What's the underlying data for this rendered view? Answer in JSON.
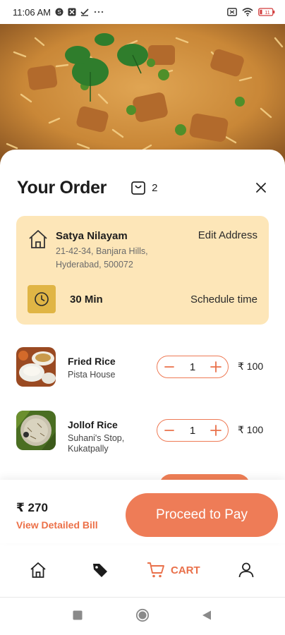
{
  "status_bar": {
    "time": "11:06 AM",
    "battery": "11"
  },
  "header": {
    "title": "Your Order",
    "cart_count": "2"
  },
  "address": {
    "name": "Satya Nilayam",
    "line1": "21-42-34, Banjara Hills,",
    "line2": "Hyderabad, 500072",
    "edit_label": "Edit Address",
    "eta": "30 Min",
    "schedule_label": "Schedule time"
  },
  "items": [
    {
      "name": "Fried Rice",
      "shop": "Pista House",
      "quantity": "1",
      "price": "₹ 100"
    },
    {
      "name": "Jollof Rice",
      "shop": "Suhani's Stop, Kukatpally",
      "quantity": "1",
      "price": "₹ 100"
    }
  ],
  "summary": {
    "total": "₹ 270",
    "bill_link": "View Detailed Bill",
    "pay_label": "Proceed to Pay"
  },
  "nav": {
    "cart_label": "CART"
  },
  "colors": {
    "accent": "#ee7c57",
    "address_bg": "#fde6b8",
    "clock_bg": "#e0b545"
  }
}
